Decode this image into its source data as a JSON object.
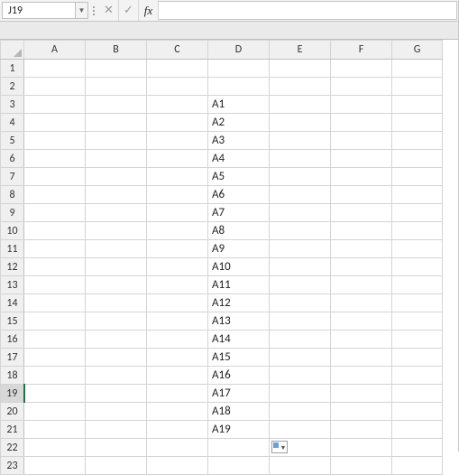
{
  "formula_bar": {
    "name_box": "J19",
    "cancel_glyph": "✕",
    "confirm_glyph": "✓",
    "fx_label": "fx",
    "formula_value": ""
  },
  "columns": [
    "A",
    "B",
    "C",
    "D",
    "E",
    "F",
    "G"
  ],
  "row_count": 23,
  "active_row": 19,
  "cells": {
    "D3": "A1",
    "D4": "A2",
    "D5": "A3",
    "D6": "A4",
    "D7": "A5",
    "D8": "A6",
    "D9": "A7",
    "D10": "A8",
    "D11": "A9",
    "D12": "A10",
    "D13": "A11",
    "D14": "A12",
    "D15": "A13",
    "D16": "A14",
    "D17": "A15",
    "D18": "A16",
    "D19": "A17",
    "D20": "A18",
    "D21": "A19"
  },
  "smart_tag": {
    "below_cell": "D21"
  }
}
